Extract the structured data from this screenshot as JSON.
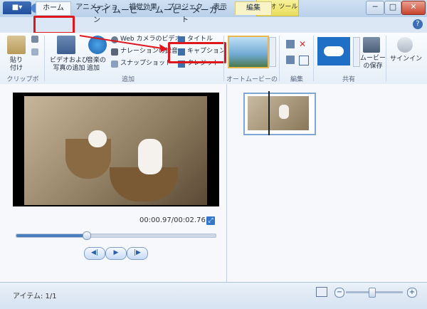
{
  "window": {
    "title": "マイ ムービー - ムービー メーカー",
    "context_tab": "ビデオ ツール",
    "controls": {
      "minimize": "─",
      "maximize": "□",
      "close": "✕"
    }
  },
  "tabs": {
    "file": "■▾",
    "home": "ホーム",
    "animation": "アニメーション",
    "visual_effects": "視覚効果",
    "project": "プロジェクト",
    "view": "表示",
    "edit": "編集",
    "help": "?"
  },
  "ribbon": {
    "clipboard": {
      "paste": "貼り\n付け",
      "group_label": "クリップボード"
    },
    "add": {
      "add_videos_photos": "ビデオおよび\n写真の追加",
      "add_music": "音楽の\n追加",
      "webcam": "Web カメラのビデオ",
      "narration": "ナレーションの録音",
      "snapshot": "スナップショット",
      "title": "タイトル",
      "caption": "キャプション",
      "credits": "クレジット",
      "group_label": "追加"
    },
    "automovie": {
      "group_label": "オートムービーのテ..."
    },
    "editing": {
      "group_label": "編集"
    },
    "share": {
      "save_movie": "ムービー\nの保存",
      "group_label": "共有"
    },
    "signin": "サインイン"
  },
  "preview": {
    "timecode": "00:00.97/00:02.76",
    "progress_fraction": 0.35
  },
  "transport": {
    "prev": "◀|",
    "play": "▶",
    "next": "|▶"
  },
  "status": {
    "items": "アイテム: 1/1",
    "zoom_out": "−",
    "zoom_in": "+"
  },
  "colors": {
    "highlight": "#e0161d",
    "accent": "#3476c9",
    "context_tab": "#e9dd5b"
  }
}
